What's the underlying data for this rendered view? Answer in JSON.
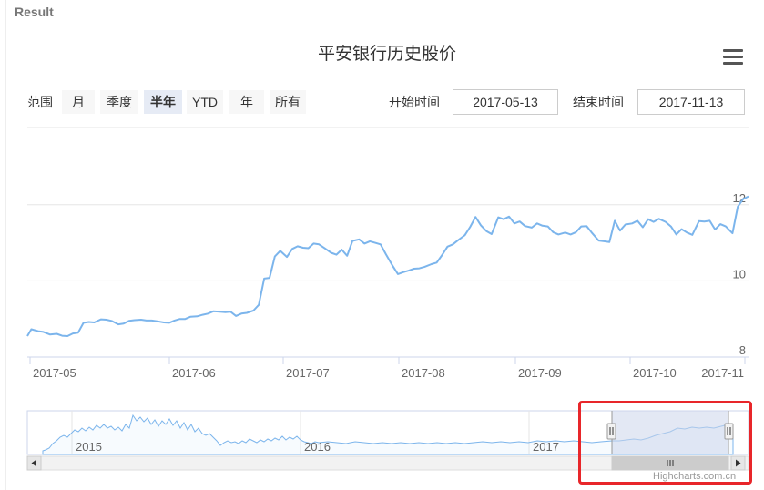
{
  "panel_label": "Result",
  "credits": "Highcharts.com.cn",
  "range_selector": {
    "label": "范围",
    "buttons": [
      "月",
      "季度",
      "半年",
      "YTD",
      "年",
      "所有"
    ],
    "selected": "半年",
    "start_label": "开始时间",
    "start_value": "2017-05-13",
    "end_label": "结束时间",
    "end_value": "2017-11-13"
  },
  "colors": {
    "line": "#7cb5ec",
    "highlight": "#e8262a",
    "navigator_mask": "#ccd6eb"
  },
  "chart_data": {
    "type": "line",
    "title": "平安银行历史股价",
    "xlabel": "",
    "ylabel": "",
    "x_ticks": [
      "2017-05",
      "2017-06",
      "2017-07",
      "2017-08",
      "2017-09",
      "2017-10",
      "2017-11"
    ],
    "y_ticks": [
      8,
      10,
      12
    ],
    "ylim": [
      8,
      12.3
    ],
    "grid": true,
    "legend": "none",
    "series": [
      {
        "values": [
          [
            0,
            8.55
          ],
          [
            3,
            8.73
          ],
          [
            8,
            8.68
          ],
          [
            12,
            8.66
          ],
          [
            17,
            8.59
          ],
          [
            22,
            8.61
          ],
          [
            26,
            8.56
          ],
          [
            30,
            8.55
          ],
          [
            34,
            8.62
          ],
          [
            38,
            8.64
          ],
          [
            42,
            8.9
          ],
          [
            46,
            8.92
          ],
          [
            50,
            8.91
          ],
          [
            55,
            8.99
          ],
          [
            59,
            8.98
          ],
          [
            63,
            8.95
          ],
          [
            68,
            8.86
          ],
          [
            72,
            8.88
          ],
          [
            76,
            8.95
          ],
          [
            80,
            8.97
          ],
          [
            85,
            8.98
          ],
          [
            89,
            8.96
          ],
          [
            93,
            8.96
          ],
          [
            97,
            8.94
          ],
          [
            102,
            8.91
          ],
          [
            106,
            8.9
          ],
          [
            110,
            8.96
          ],
          [
            114,
            9.0
          ],
          [
            118,
            9.0
          ],
          [
            122,
            9.06
          ],
          [
            127,
            9.07
          ],
          [
            131,
            9.11
          ],
          [
            135,
            9.14
          ],
          [
            139,
            9.2
          ],
          [
            144,
            9.19
          ],
          [
            148,
            9.18
          ],
          [
            152,
            9.19
          ],
          [
            156,
            9.08
          ],
          [
            160,
            9.14
          ],
          [
            164,
            9.16
          ],
          [
            169,
            9.22
          ],
          [
            173,
            9.37
          ],
          [
            177,
            10.06
          ],
          [
            181,
            10.08
          ],
          [
            185,
            10.64
          ],
          [
            189,
            10.79
          ],
          [
            194,
            10.63
          ],
          [
            198,
            10.84
          ],
          [
            202,
            10.91
          ],
          [
            206,
            10.87
          ],
          [
            210,
            10.86
          ],
          [
            214,
            10.98
          ],
          [
            218,
            10.96
          ],
          [
            223,
            10.84
          ],
          [
            227,
            10.74
          ],
          [
            231,
            10.69
          ],
          [
            235,
            10.82
          ],
          [
            239,
            10.66
          ],
          [
            243,
            11.05
          ],
          [
            248,
            11.09
          ],
          [
            252,
            10.98
          ],
          [
            256,
            11.04
          ],
          [
            260,
            11.0
          ],
          [
            264,
            10.96
          ],
          [
            268,
            10.7
          ],
          [
            273,
            10.4
          ],
          [
            277,
            10.18
          ],
          [
            281,
            10.23
          ],
          [
            285,
            10.27
          ],
          [
            289,
            10.32
          ],
          [
            293,
            10.33
          ],
          [
            297,
            10.37
          ],
          [
            302,
            10.44
          ],
          [
            306,
            10.48
          ],
          [
            310,
            10.68
          ],
          [
            314,
            10.9
          ],
          [
            318,
            10.96
          ],
          [
            322,
            11.07
          ],
          [
            327,
            11.2
          ],
          [
            331,
            11.42
          ],
          [
            335,
            11.68
          ],
          [
            339,
            11.46
          ],
          [
            343,
            11.31
          ],
          [
            347,
            11.23
          ],
          [
            352,
            11.67
          ],
          [
            356,
            11.62
          ],
          [
            360,
            11.69
          ],
          [
            364,
            11.51
          ],
          [
            368,
            11.56
          ],
          [
            372,
            11.44
          ],
          [
            377,
            11.4
          ],
          [
            381,
            11.51
          ],
          [
            385,
            11.45
          ],
          [
            389,
            11.43
          ],
          [
            393,
            11.28
          ],
          [
            397,
            11.22
          ],
          [
            402,
            11.27
          ],
          [
            406,
            11.22
          ],
          [
            410,
            11.28
          ],
          [
            414,
            11.43
          ],
          [
            418,
            11.44
          ],
          [
            422,
            11.26
          ],
          [
            427,
            11.06
          ],
          [
            431,
            11.04
          ],
          [
            435,
            11.02
          ],
          [
            439,
            11.58
          ],
          [
            443,
            11.32
          ],
          [
            447,
            11.48
          ],
          [
            452,
            11.51
          ],
          [
            456,
            11.58
          ],
          [
            460,
            11.41
          ],
          [
            464,
            11.62
          ],
          [
            468,
            11.55
          ],
          [
            472,
            11.63
          ],
          [
            477,
            11.55
          ],
          [
            481,
            11.43
          ],
          [
            485,
            11.22
          ],
          [
            489,
            11.36
          ],
          [
            493,
            11.27
          ],
          [
            497,
            11.21
          ],
          [
            502,
            11.57
          ],
          [
            506,
            11.56
          ],
          [
            510,
            11.58
          ],
          [
            514,
            11.35
          ],
          [
            518,
            11.49
          ],
          [
            522,
            11.43
          ],
          [
            527,
            11.25
          ],
          [
            531,
            11.95
          ],
          [
            535,
            12.15
          ],
          [
            539,
            12.22
          ]
        ]
      }
    ]
  }
}
